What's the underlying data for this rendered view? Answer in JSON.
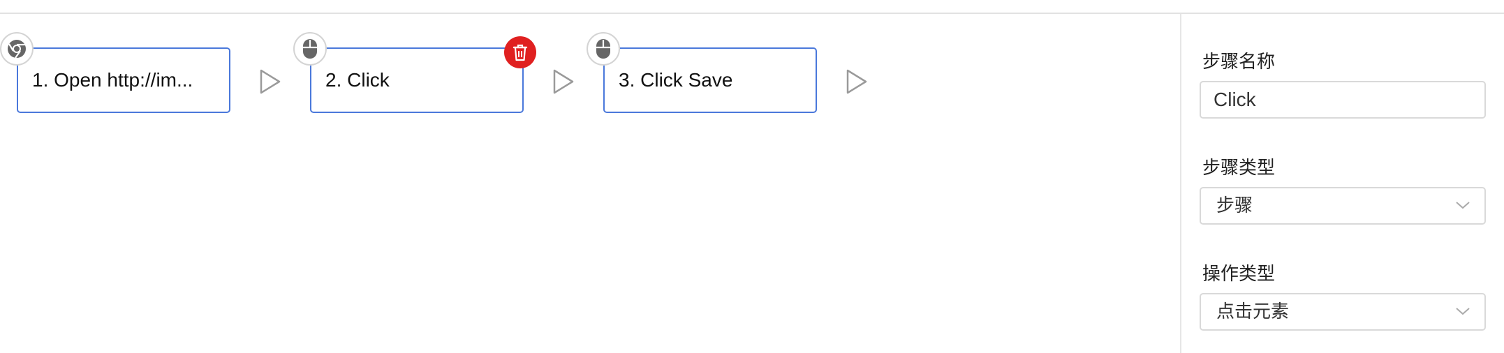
{
  "steps": [
    {
      "label": "1. Open http://im...",
      "icon": "chrome-icon"
    },
    {
      "label": "2. Click",
      "icon": "mouse-icon"
    },
    {
      "label": "3. Click Save",
      "icon": "mouse-icon"
    }
  ],
  "colors": {
    "accent": "#4a78db",
    "delete": "#e02020"
  },
  "panel": {
    "step_name": {
      "label": "步骤名称",
      "value": "Click"
    },
    "step_type": {
      "label": "步骤类型",
      "value": "步骤"
    },
    "action_type": {
      "label": "操作类型",
      "value": "点击元素"
    }
  }
}
